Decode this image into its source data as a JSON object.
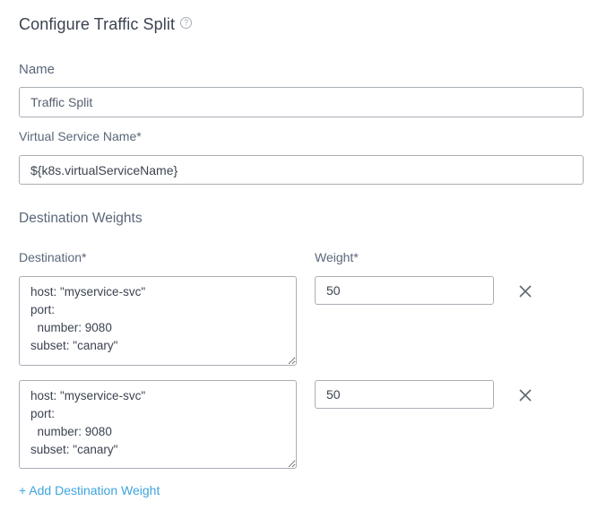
{
  "form": {
    "title": "Configure Traffic Split",
    "help_icon_glyph": "?",
    "name": {
      "label": "Name",
      "value": "Traffic Split"
    },
    "virtual_service": {
      "label": "Virtual Service Name*",
      "value": "${k8s.virtualServiceName}"
    },
    "destination_weights": {
      "section_title": "Destination Weights",
      "destination_label": "Destination*",
      "weight_label": "Weight*",
      "rows": [
        {
          "destination": "host: \"myservice-svc\"\nport:\n  number: 9080\nsubset: \"canary\"",
          "weight": "50"
        },
        {
          "destination": "host: \"myservice-svc\"\nport:\n  number: 9080\nsubset: \"canary\"",
          "weight": "50"
        }
      ],
      "add_label": "+ Add Destination Weight"
    }
  },
  "icons": {
    "help": "help-circle-icon",
    "remove": "close-icon"
  },
  "colors": {
    "link": "#3da5dd",
    "label": "#5a6779",
    "title": "#3b4350",
    "border": "#a9aeb6"
  }
}
